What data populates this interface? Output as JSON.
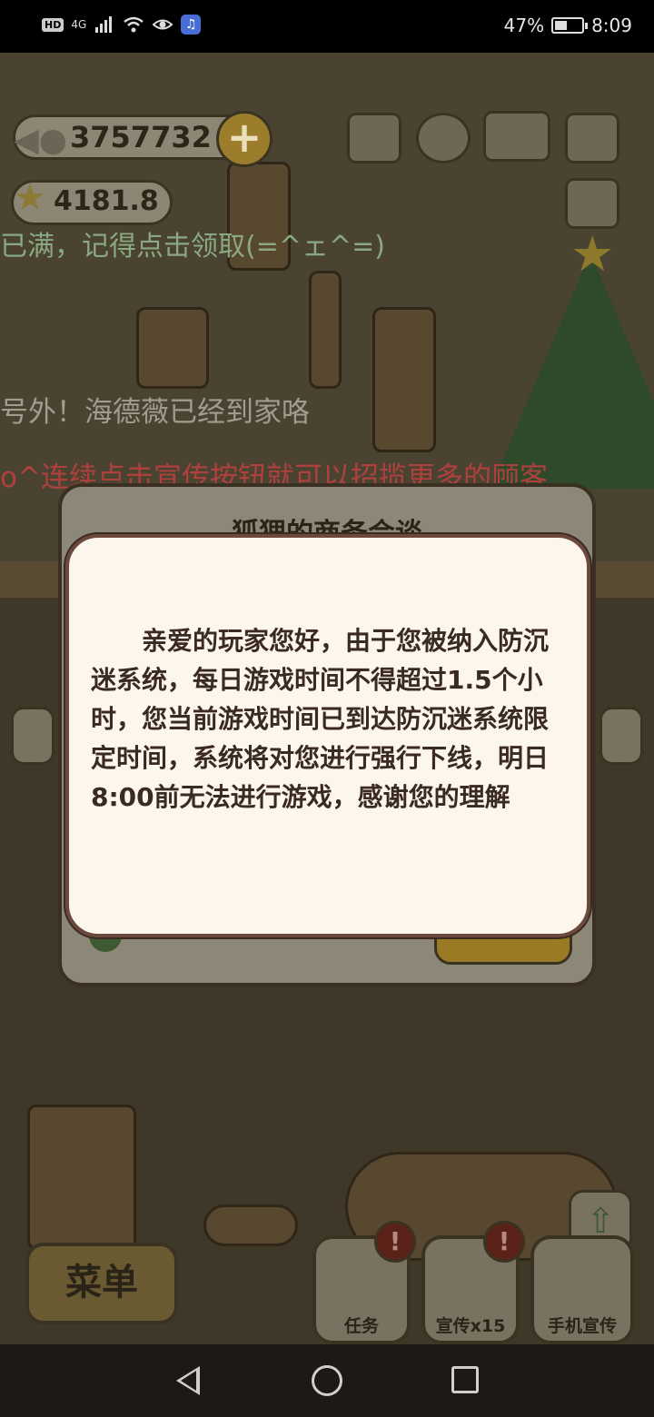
{
  "status_bar": {
    "network": "4G",
    "badge_hd": "HD",
    "battery_percent": "47%",
    "battery_level": 0.47,
    "time": "8:09"
  },
  "hud": {
    "fish_count": "3757732",
    "star_count": "4181.8",
    "plus_label": "+"
  },
  "messages": {
    "line1": "已满，记得点击领取(=^ェ^=)",
    "line2": "号外！海德薇已经到家咯",
    "line3": "o^连续点击宣传按钮就可以招揽更多的顾客"
  },
  "background_dialog": {
    "title": "狐狸的商务会谈"
  },
  "notice": {
    "text": "亲爱的玩家您好，由于您被纳入防沉迷系统，每日游戏时间不得超过1.5个小时，您当前游戏时间已到达防沉迷系统限定时间，系统将对您进行强行下线，明日8:00前无法进行游戏，感谢您的理解"
  },
  "bottom": {
    "menu_label": "菜单",
    "task_label": "任务",
    "promote_label": "宣传x15",
    "phone_promote_label": "手机宣传",
    "badge_symbol": "!"
  },
  "icons": [
    "fish-icon",
    "star-icon",
    "plus-icon",
    "ranking-icon",
    "settings-icon",
    "book-icon",
    "camera-icon",
    "card-icon",
    "arrow-left-icon",
    "arrow-right-icon",
    "up-arrow-icon",
    "back-icon",
    "home-icon",
    "recent-apps-icon"
  ]
}
